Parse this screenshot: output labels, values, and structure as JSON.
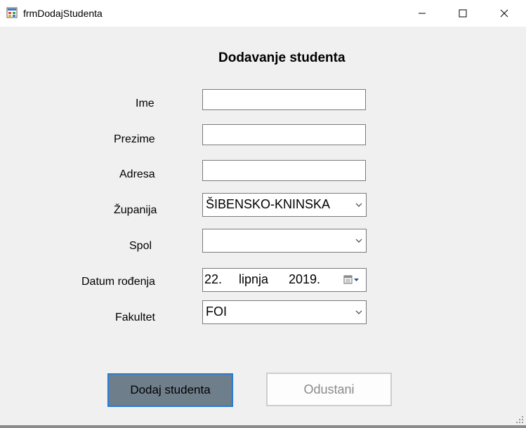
{
  "window": {
    "title": "frmDodajStudenta",
    "controls": [
      "minimize-icon",
      "maximize-icon",
      "close-icon"
    ]
  },
  "form": {
    "heading": "Dodavanje studenta",
    "labels": {
      "ime": "Ime",
      "prezime": "Prezime",
      "adresa": "Adresa",
      "zupanija": "Županija",
      "spol": "Spol",
      "datum": "Datum rođenja",
      "fakultet": "Fakultet"
    },
    "fields": {
      "ime": "",
      "prezime": "",
      "adresa": "",
      "zupanija": "ŠIBENSKO-KNINSKA",
      "spol": "",
      "datum": {
        "day": "22.",
        "month": "lipnja",
        "year": "2019."
      },
      "fakultet": "FOI"
    },
    "buttons": {
      "add": "Dodaj studenta",
      "cancel": "Odustani"
    }
  },
  "colors": {
    "client_bg": "#f0f0f0",
    "primary_button_bg": "#6f7e8b",
    "focus_border": "#2a7bd1"
  }
}
